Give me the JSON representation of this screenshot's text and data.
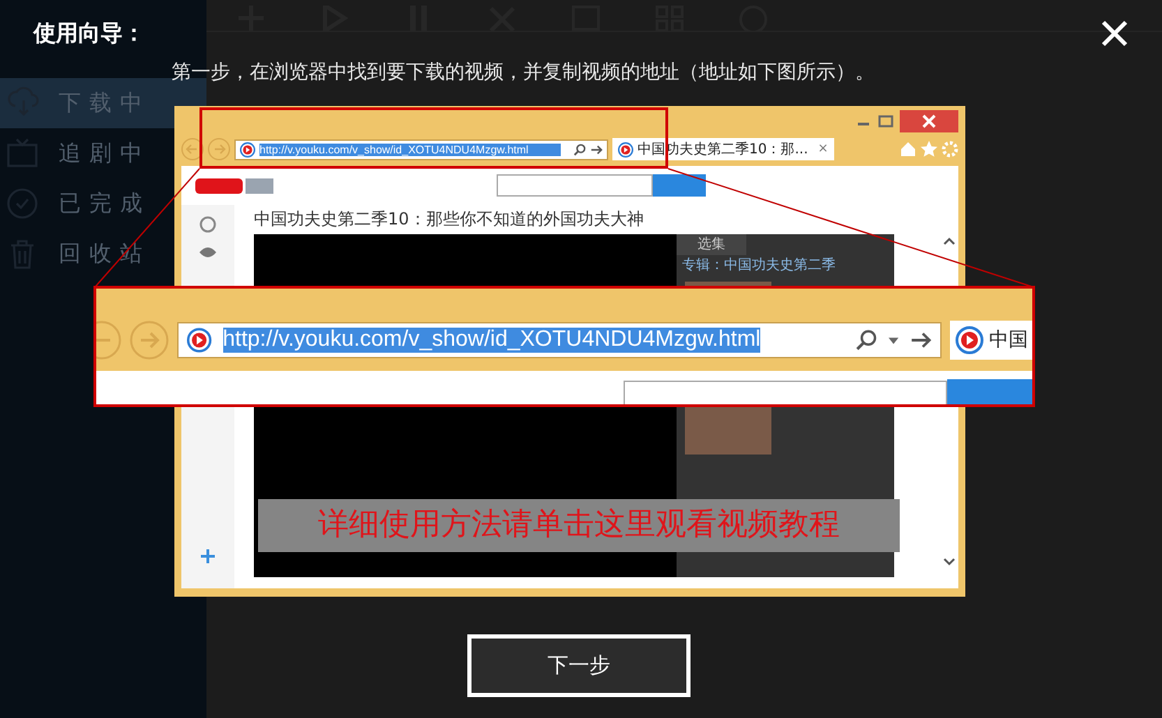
{
  "sidebar": {
    "items": [
      {
        "label": "下载中",
        "selected": true
      },
      {
        "label": "追剧中",
        "selected": false
      },
      {
        "label": "已完成",
        "selected": false
      },
      {
        "label": "回收站",
        "selected": false
      }
    ]
  },
  "guide": {
    "title": "使用向导：",
    "step_text": "第一步，在浏览器中找到要下载的视频，并复制视频的地址（地址如下图所示）。",
    "browser": {
      "url": "http://v.youku.com/v_show/id_XOTU4NDU4Mzgw.html",
      "tab_title": "中国功夫史第二季10：那...",
      "tab_close": "×",
      "page_title": "中国功夫史第二季10：那些你不知道的外国功夫大神",
      "episodes_tab": "选集",
      "album_label": "专辑：中国功夫史第二季"
    },
    "zoom_callout": {
      "url": "http://v.youku.com/v_show/id_XOTU4NDU4Mzgw.html",
      "tab_title": "中国"
    },
    "tutorial_link": "详细使用方法请单击这里观看视频教程",
    "next_button": "下一步"
  }
}
